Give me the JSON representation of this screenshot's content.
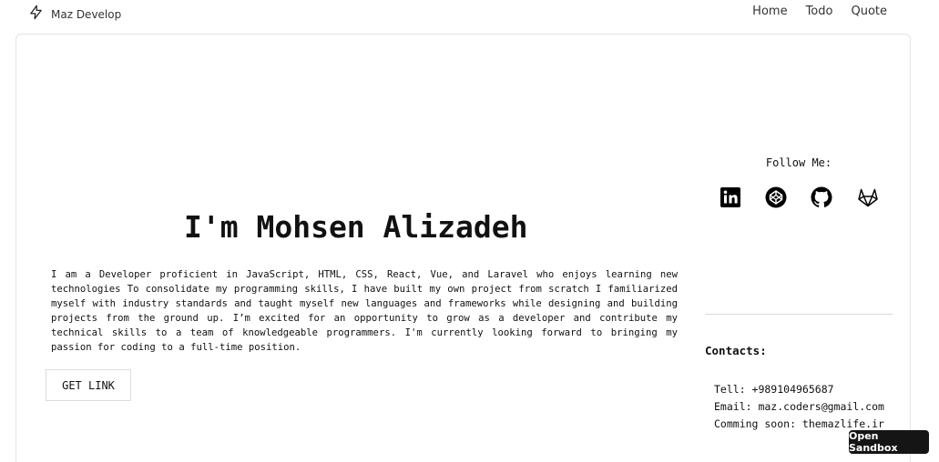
{
  "nav": {
    "brand": "Maz Develop",
    "brand_icon": "lightning-bolt-icon",
    "links": [
      "Home",
      "Todo",
      "Quote"
    ]
  },
  "hero": {
    "title": "I'm Mohsen Alizadeh",
    "bio": "I am a Developer proficient in JavaScript, HTML, CSS, React, Vue, and Laravel who enjoys learning new technologies To consolidate my programming skills, I have built my own project from scratch I familiarized myself with industry standards and taught myself new languages and frameworks while designing and building projects from the ground up. I’m excited for an opportunity to grow as a developer and contribute my technical skills to a team of knowledgeable programmers. I'm currently looking forward to bringing my passion for coding to a full-time position.",
    "button_label": "GET LINK"
  },
  "follow": {
    "title": "Follow Me:",
    "icons": [
      "linkedin-icon",
      "codepen-icon",
      "github-icon",
      "gitlab-icon"
    ]
  },
  "contacts": {
    "title": "Contacts:",
    "lines": [
      "Tell: +989104965687",
      "Email: maz.coders@gmail.com",
      "Comming soon: themazlife.ir"
    ]
  },
  "sandbox": {
    "label": "Open Sandbox"
  },
  "colors": {
    "text": "#111111",
    "border": "#e3e3e3",
    "sandbox_bg": "#151515"
  }
}
